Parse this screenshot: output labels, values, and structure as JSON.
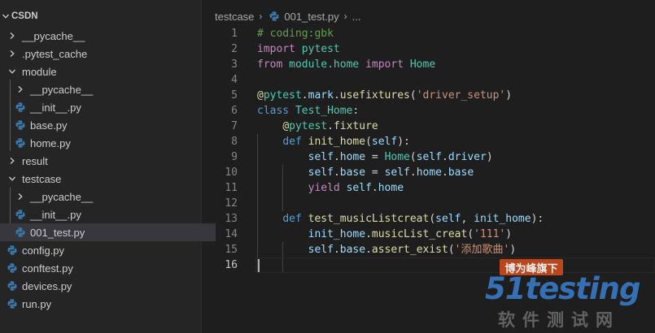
{
  "explorer": {
    "root_label": "CSDN",
    "items": [
      {
        "label": "__pycache__",
        "type": "folder",
        "state": "collapsed",
        "depth": 0
      },
      {
        "label": ".pytest_cache",
        "type": "folder",
        "state": "collapsed",
        "depth": 0
      },
      {
        "label": "module",
        "type": "folder",
        "state": "expanded",
        "depth": 0
      },
      {
        "label": "__pycache__",
        "type": "folder",
        "state": "collapsed",
        "depth": 1
      },
      {
        "label": "__init__.py",
        "type": "python-file",
        "depth": 1
      },
      {
        "label": "base.py",
        "type": "python-file",
        "depth": 1
      },
      {
        "label": "home.py",
        "type": "python-file",
        "depth": 1
      },
      {
        "label": "result",
        "type": "folder",
        "state": "collapsed",
        "depth": 0
      },
      {
        "label": "testcase",
        "type": "folder",
        "state": "expanded",
        "depth": 0
      },
      {
        "label": "__pycache__",
        "type": "folder",
        "state": "collapsed",
        "depth": 1
      },
      {
        "label": "__init__.py",
        "type": "python-file",
        "depth": 1
      },
      {
        "label": "001_test.py",
        "type": "python-file",
        "depth": 1,
        "selected": true
      },
      {
        "label": "config.py",
        "type": "python-file",
        "depth": 0
      },
      {
        "label": "conftest.py",
        "type": "python-file",
        "depth": 0
      },
      {
        "label": "devices.py",
        "type": "python-file",
        "depth": 0
      },
      {
        "label": "run.py",
        "type": "python-file",
        "depth": 0
      }
    ]
  },
  "breadcrumb": {
    "folder": "testcase",
    "file": "001_test.py",
    "more": "..."
  },
  "editor": {
    "active_line": 16,
    "lines": [
      {
        "num": "1",
        "tokens": [
          {
            "t": "# coding:gbk",
            "c": "cm"
          }
        ]
      },
      {
        "num": "2",
        "tokens": [
          {
            "t": "import",
            "c": "kw"
          },
          {
            "t": " ",
            "c": "pl"
          },
          {
            "t": "pytest",
            "c": "cls"
          }
        ]
      },
      {
        "num": "3",
        "tokens": [
          {
            "t": "from",
            "c": "kw"
          },
          {
            "t": " ",
            "c": "pl"
          },
          {
            "t": "module.home",
            "c": "cls"
          },
          {
            "t": " ",
            "c": "pl"
          },
          {
            "t": "import",
            "c": "kw"
          },
          {
            "t": " ",
            "c": "pl"
          },
          {
            "t": "Home",
            "c": "cls"
          }
        ]
      },
      {
        "num": "4",
        "tokens": []
      },
      {
        "num": "5",
        "tokens": [
          {
            "t": "@",
            "c": "fn"
          },
          {
            "t": "pytest",
            "c": "cls"
          },
          {
            "t": ".",
            "c": "pl"
          },
          {
            "t": "mark",
            "c": "id"
          },
          {
            "t": ".",
            "c": "pl"
          },
          {
            "t": "usefixtures",
            "c": "fn"
          },
          {
            "t": "(",
            "c": "pl"
          },
          {
            "t": "'driver_setup'",
            "c": "st"
          },
          {
            "t": ")",
            "c": "pl"
          }
        ]
      },
      {
        "num": "6",
        "tokens": [
          {
            "t": "class",
            "c": "kw2"
          },
          {
            "t": " ",
            "c": "pl"
          },
          {
            "t": "Test_Home",
            "c": "cls"
          },
          {
            "t": ":",
            "c": "pl"
          }
        ]
      },
      {
        "num": "7",
        "tokens": [
          {
            "t": "    ",
            "c": "pl"
          },
          {
            "t": "@",
            "c": "fn"
          },
          {
            "t": "pytest",
            "c": "cls"
          },
          {
            "t": ".",
            "c": "pl"
          },
          {
            "t": "fixture",
            "c": "fn"
          }
        ]
      },
      {
        "num": "8",
        "tokens": [
          {
            "t": "    ",
            "c": "pl"
          },
          {
            "t": "def",
            "c": "kw2"
          },
          {
            "t": " ",
            "c": "pl"
          },
          {
            "t": "init_home",
            "c": "fn"
          },
          {
            "t": "(",
            "c": "pl"
          },
          {
            "t": "self",
            "c": "id"
          },
          {
            "t": "):",
            "c": "pl"
          }
        ]
      },
      {
        "num": "9",
        "tokens": [
          {
            "t": "        ",
            "c": "pl"
          },
          {
            "t": "self",
            "c": "id"
          },
          {
            "t": ".",
            "c": "pl"
          },
          {
            "t": "home",
            "c": "id"
          },
          {
            "t": " = ",
            "c": "pl"
          },
          {
            "t": "Home",
            "c": "cls"
          },
          {
            "t": "(",
            "c": "pl"
          },
          {
            "t": "self",
            "c": "id"
          },
          {
            "t": ".",
            "c": "pl"
          },
          {
            "t": "driver",
            "c": "id"
          },
          {
            "t": ")",
            "c": "pl"
          }
        ]
      },
      {
        "num": "10",
        "tokens": [
          {
            "t": "        ",
            "c": "pl"
          },
          {
            "t": "self",
            "c": "id"
          },
          {
            "t": ".",
            "c": "pl"
          },
          {
            "t": "base",
            "c": "id"
          },
          {
            "t": " = ",
            "c": "pl"
          },
          {
            "t": "self",
            "c": "id"
          },
          {
            "t": ".",
            "c": "pl"
          },
          {
            "t": "home",
            "c": "id"
          },
          {
            "t": ".",
            "c": "pl"
          },
          {
            "t": "base",
            "c": "id"
          }
        ]
      },
      {
        "num": "11",
        "tokens": [
          {
            "t": "        ",
            "c": "pl"
          },
          {
            "t": "yield",
            "c": "kw"
          },
          {
            "t": " ",
            "c": "pl"
          },
          {
            "t": "self",
            "c": "id"
          },
          {
            "t": ".",
            "c": "pl"
          },
          {
            "t": "home",
            "c": "id"
          }
        ]
      },
      {
        "num": "12",
        "tokens": []
      },
      {
        "num": "13",
        "tokens": [
          {
            "t": "    ",
            "c": "pl"
          },
          {
            "t": "def",
            "c": "kw2"
          },
          {
            "t": " ",
            "c": "pl"
          },
          {
            "t": "test_musicListcreat",
            "c": "fn"
          },
          {
            "t": "(",
            "c": "pl"
          },
          {
            "t": "self",
            "c": "id"
          },
          {
            "t": ", ",
            "c": "pl"
          },
          {
            "t": "init_home",
            "c": "id"
          },
          {
            "t": "):",
            "c": "pl"
          }
        ]
      },
      {
        "num": "14",
        "tokens": [
          {
            "t": "        ",
            "c": "pl"
          },
          {
            "t": "init_home",
            "c": "id"
          },
          {
            "t": ".",
            "c": "pl"
          },
          {
            "t": "musicList_creat",
            "c": "fn"
          },
          {
            "t": "(",
            "c": "pl"
          },
          {
            "t": "'111'",
            "c": "st"
          },
          {
            "t": ")",
            "c": "pl"
          }
        ]
      },
      {
        "num": "15",
        "tokens": [
          {
            "t": "        ",
            "c": "pl"
          },
          {
            "t": "self",
            "c": "id"
          },
          {
            "t": ".",
            "c": "pl"
          },
          {
            "t": "base",
            "c": "id"
          },
          {
            "t": ".",
            "c": "pl"
          },
          {
            "t": "assert_exist",
            "c": "fn"
          },
          {
            "t": "(",
            "c": "pl"
          },
          {
            "t": "'添加歌曲'",
            "c": "st"
          },
          {
            "t": ")",
            "c": "pl"
          }
        ]
      },
      {
        "num": "16",
        "tokens": []
      }
    ]
  },
  "watermark": {
    "badge": "博为峰旗下",
    "logo": "51testing",
    "subtitle": "软件测试网"
  },
  "colors": {
    "sidebar_bg": "#252526",
    "editor_bg": "#1e1e1e",
    "selected_row": "#37373d",
    "python_icon": "#3b77a8"
  }
}
